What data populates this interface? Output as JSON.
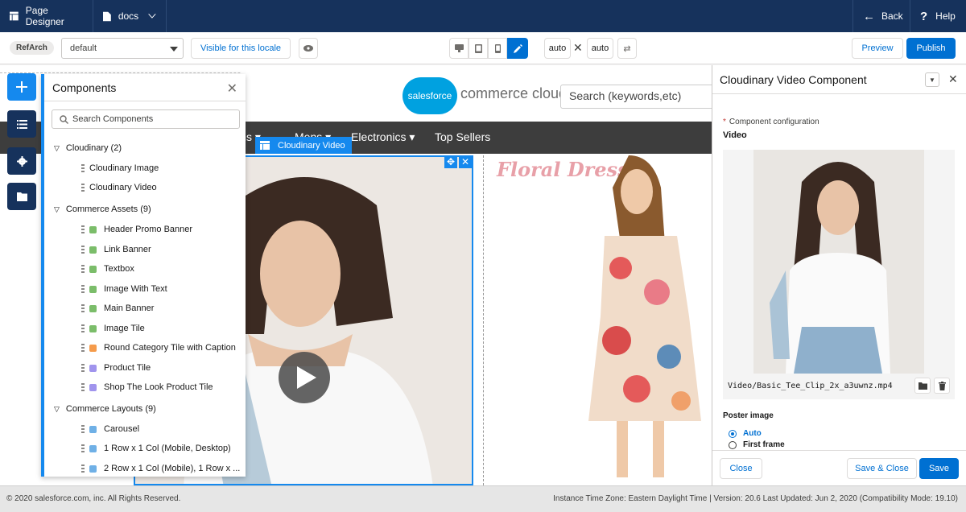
{
  "topbar": {
    "app_name": "Page Designer",
    "site_name": "docs",
    "back_label": "Back",
    "help_label": "Help"
  },
  "toolbar": {
    "site_pill": "RefArch",
    "locale_value": "default",
    "visibility_label": "Visible for this locale",
    "width_value": "auto",
    "height_value": "auto",
    "preview_label": "Preview",
    "publish_label": "Publish"
  },
  "storefront": {
    "logo_badge": "salesforce",
    "logo_text": "commerce cloud",
    "search_placeholder": "Search (keywords,etc)",
    "nav": [
      "Womens ▾",
      "Mens ▾",
      "Electronics ▾",
      "Top Sellers"
    ],
    "selected_component_label": "Cloudinary Video",
    "promo_title": "Floral Dress"
  },
  "components_panel": {
    "title": "Components",
    "search_placeholder": "Search Components",
    "groups": [
      {
        "label": "Cloudinary (2)",
        "items": [
          "Cloudinary Image",
          "Cloudinary Video"
        ]
      },
      {
        "label": "Commerce Assets (9)",
        "items": [
          "Header Promo Banner",
          "Link Banner",
          "Textbox",
          "Image With Text",
          "Main Banner",
          "Image Tile",
          "Round Category Tile with Caption",
          "Product Tile",
          "Shop The Look Product Tile"
        ]
      },
      {
        "label": "Commerce Layouts (9)",
        "items": [
          "Carousel",
          "1 Row x 1 Col (Mobile, Desktop)",
          "2 Row x 1 Col (Mobile), 1 Row x ..."
        ]
      }
    ]
  },
  "config_panel": {
    "title": "Cloudinary Video Component",
    "config_label": "Component configuration",
    "video_label": "Video",
    "video_file": "Video/Basic_Tee_Clip_2x_a3uwnz.mp4",
    "poster_label": "Poster image",
    "poster_options": [
      "Auto",
      "First frame"
    ],
    "poster_selected": "Auto",
    "close_label": "Close",
    "save_close_label": "Save & Close",
    "save_label": "Save"
  },
  "footer": {
    "copyright": "© 2020 salesforce.com, inc. All Rights Reserved.",
    "instance_info": "Instance Time Zone: Eastern Daylight Time | Version: 20.6 Last Updated: Jun 2, 2020 (Compatibility Mode: 19.10)"
  },
  "colors": {
    "navy": "#16325c",
    "brand_blue": "#0070d2",
    "selection_blue": "#1589ee"
  }
}
